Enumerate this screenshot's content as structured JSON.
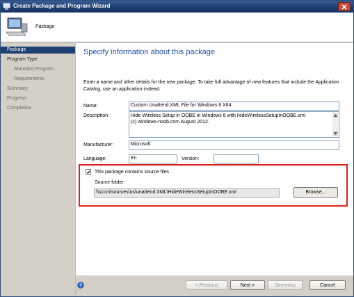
{
  "window": {
    "title": "Create Package and Program Wizard"
  },
  "header": {
    "title": "Package"
  },
  "sidebar": {
    "items": [
      {
        "label": "Package"
      },
      {
        "label": "Program Type"
      },
      {
        "label": "Standard Program"
      },
      {
        "label": "Requirements"
      },
      {
        "label": "Summary"
      },
      {
        "label": "Progress"
      },
      {
        "label": "Completion"
      }
    ]
  },
  "main": {
    "heading": "Specify information about this package",
    "intro": "Enter a name and other details for the new package. To take full advantage of new features that include the Application Catalog, use an application instead.",
    "name_label": "Name:",
    "name_value": "Custom Unattend.XML File  for Windows 8 X64",
    "description_label": "Description:",
    "description_line1": "Hide Wireless Setup in OOBE in Windows 8 with HideWirelessSetupInOOBE.xml",
    "description_line2": "(c) windows-noob.com August 2012.",
    "manufacturer_label": "Manufacturer:",
    "manufacturer_value": "Microsoft",
    "language_label": "Language:",
    "language_value": "En",
    "version_label": "Version:",
    "version_value": "",
    "source_checkbox_label": "This package contains source files",
    "source_folder_label": "Source folder:",
    "source_folder_value": "\\\\sccm\\sources\\os\\unattend XML\\HideWirelessSetupInOOBE.xml",
    "browse_label": "Browse..."
  },
  "footer": {
    "previous_label": "< Previous",
    "next_label": "Next >",
    "summary_label": "Summary",
    "cancel_label": "Cancel"
  }
}
